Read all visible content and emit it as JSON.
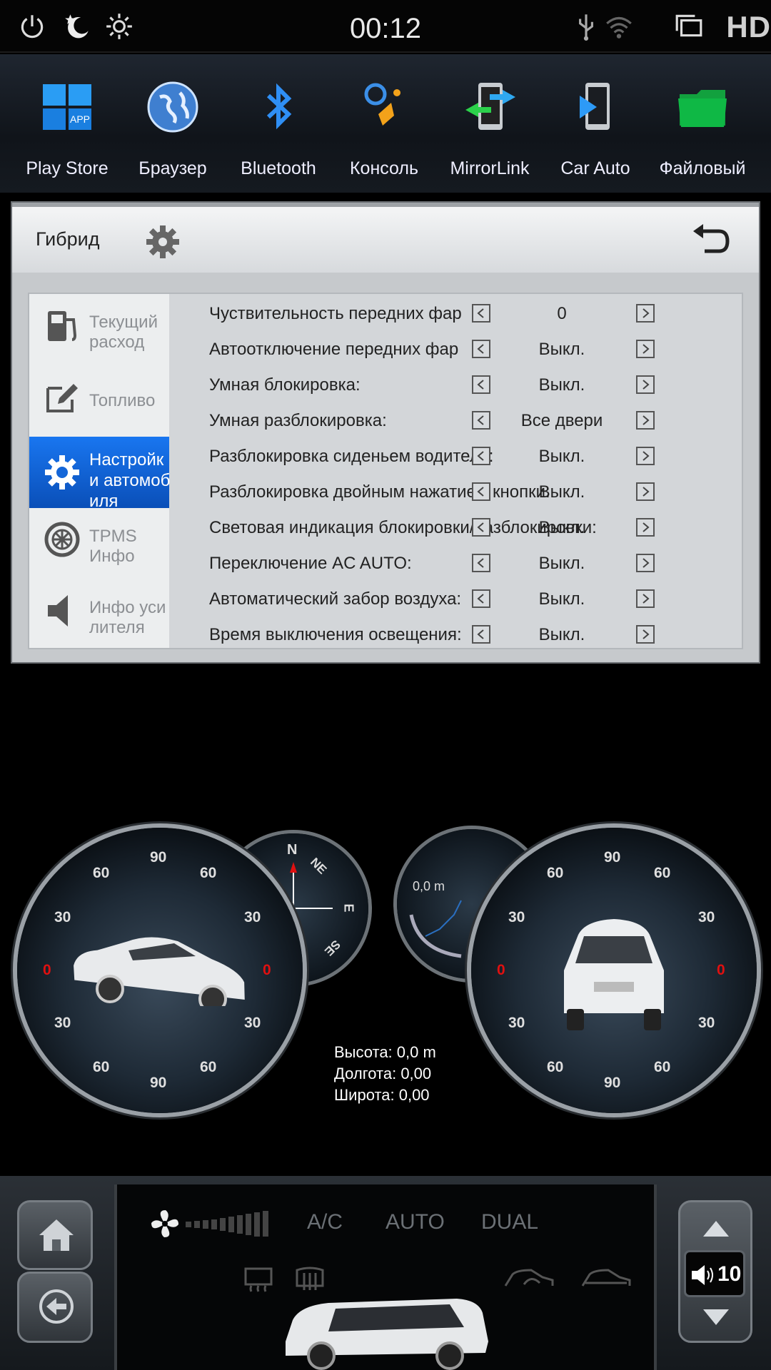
{
  "status_bar": {
    "time": "00:12",
    "hd_label": "HD"
  },
  "dock": {
    "apps": [
      {
        "label": "Play Store",
        "icon": "app-grid-icon"
      },
      {
        "label": "Браузер",
        "icon": "globe-icon"
      },
      {
        "label": "Bluetooth",
        "icon": "bluetooth-icon"
      },
      {
        "label": "Консоль",
        "icon": "steering-wheel-icon"
      },
      {
        "label": "MirrorLink",
        "icon": "mirrorlink-icon"
      },
      {
        "label": "Car Auto",
        "icon": "car-auto-phone-icon"
      },
      {
        "label": "Файловый",
        "icon": "folder-icon"
      }
    ]
  },
  "panel": {
    "title": "Гибрид",
    "sidebar": [
      {
        "label": "Текущий\nрасход",
        "icon": "fuel-pump-icon"
      },
      {
        "label": "Топливо",
        "icon": "edit-note-icon"
      },
      {
        "label": "Настройк\nи автомоб\nиля",
        "icon": "settings-gear-icon",
        "active": true
      },
      {
        "label": "TPMS\nИнфо",
        "icon": "tire-icon"
      },
      {
        "label": "Инфо уси\nлителя",
        "icon": "speaker-icon"
      }
    ],
    "rows": [
      {
        "label": "Чуствительность передних фар",
        "value": "0"
      },
      {
        "label": "Автоотключение передних фар",
        "value": "Выкл."
      },
      {
        "label": "Умная блокировка:",
        "value": "Выкл."
      },
      {
        "label": "Умная разблокировка:",
        "value": "Все двери"
      },
      {
        "label": "Разблокировка сиденьем водителя:",
        "value": "Выкл."
      },
      {
        "label": "Разблокировка двойным нажатием кнопки:",
        "value": "Выкл."
      },
      {
        "label": "Световая индикация блокировки/разблокировки:",
        "value": "Выкл."
      },
      {
        "label": "Переключение AC AUTO:",
        "value": "Выкл."
      },
      {
        "label": "Автоматический забор воздуха:",
        "value": "Выкл."
      },
      {
        "label": "Время выключения освещения:",
        "value": "Выкл."
      }
    ]
  },
  "gauges": {
    "ticks": {
      "t60": "60",
      "t90": "90",
      "t30": "30",
      "t0": "0"
    },
    "compass": {
      "n": "N",
      "ne": "NE",
      "e": "E",
      "se": "SE",
      "nw": "N"
    },
    "altimeter_label": "0,0 m",
    "gps": {
      "altitude": "Высота: 0,0 m",
      "longitude": "Долгота: 0,00",
      "latitude": "Широта: 0,00"
    }
  },
  "climate": {
    "ac": "A/C",
    "auto": "AUTO",
    "dual": "DUAL",
    "fan_level": 0
  },
  "volume": {
    "value": "10"
  },
  "colors": {
    "accent": "#1976f0",
    "panel": "#c6c9cc",
    "redTick": "#e01010"
  }
}
